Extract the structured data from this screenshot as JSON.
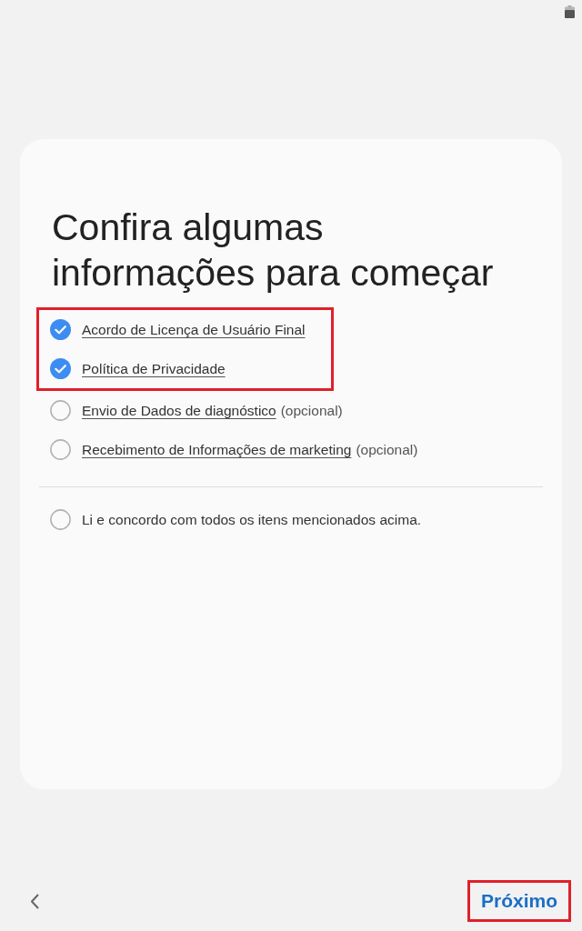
{
  "title": "Confira algumas informações para começar",
  "items": [
    {
      "label": "Acordo de Licença de Usuário Final",
      "checked": true,
      "highlighted": true
    },
    {
      "label": "Política de Privacidade",
      "checked": true,
      "highlighted": true
    },
    {
      "label": "Envio de Dados de diagnóstico",
      "suffix": "(opcional)",
      "checked": false,
      "highlighted": false
    },
    {
      "label": "Recebimento de Informações de marketing",
      "suffix": "(opcional)",
      "checked": false,
      "highlighted": false
    }
  ],
  "agree_all": {
    "label": "Li e concordo com todos os itens mencionados acima.",
    "checked": false
  },
  "navigation": {
    "next_button": {
      "label": "Próximo",
      "highlighted": true
    }
  }
}
